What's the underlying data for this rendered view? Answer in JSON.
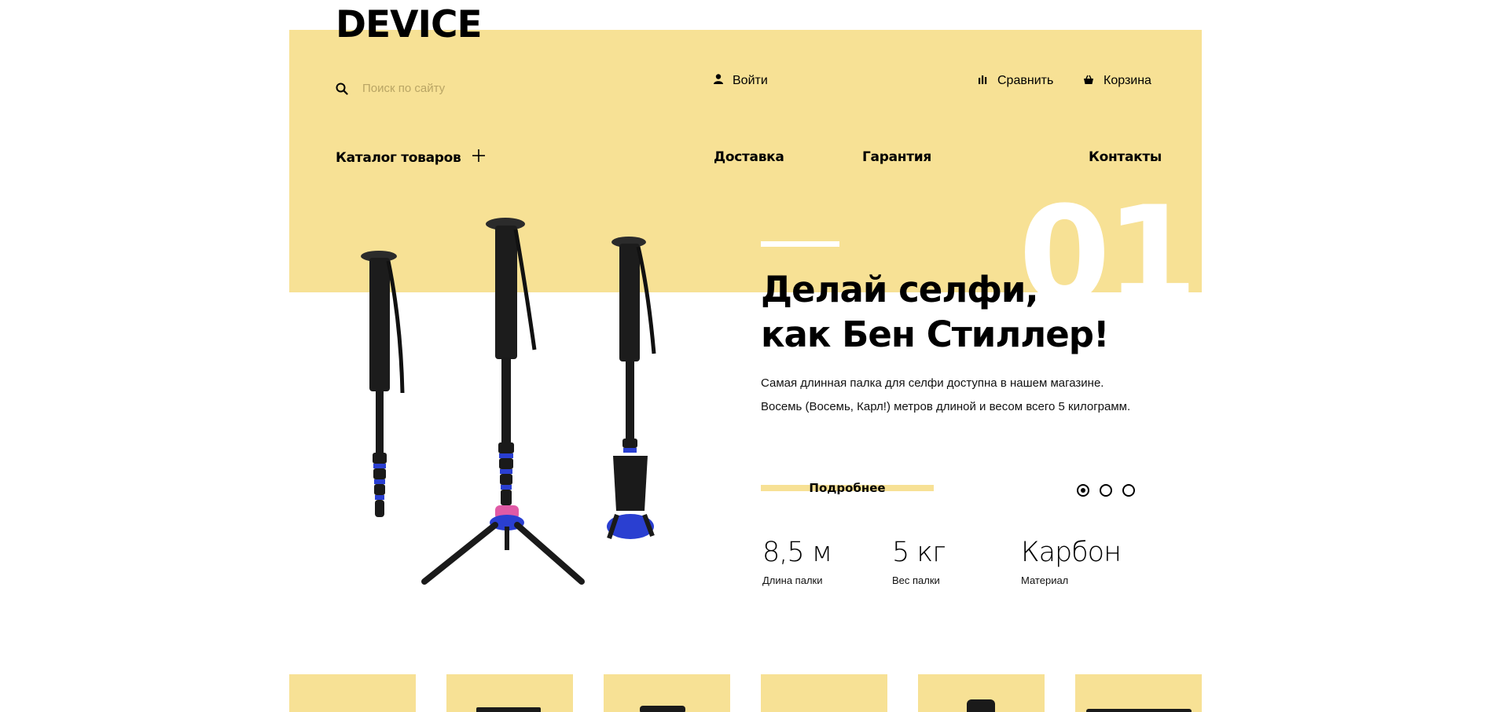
{
  "header": {
    "logo": "DEVICE",
    "search": {
      "placeholder": "Поиск по сайту",
      "icon": "search-icon"
    },
    "login": {
      "label": "Войти",
      "icon": "user-icon"
    },
    "compare": {
      "label": "Сравнить",
      "icon": "bar-chart-icon"
    },
    "cart": {
      "label": "Корзина",
      "icon": "basket-icon"
    }
  },
  "nav": {
    "catalog": "Каталог товаров",
    "delivery": "Доставка",
    "warranty": "Гарантия",
    "contacts": "Контакты"
  },
  "slider": {
    "number": "01",
    "headline_line1": "Делай селфи,",
    "headline_line2": "как Бен Стиллер!",
    "description_line1": "Самая длинная палка для селфи доступна в нашем магазине.",
    "description_line2": "Восемь (Восемь, Карл!) метров длиной и весом всего 5 килограмм.",
    "more_button": "Подробнее",
    "dots_count": 3,
    "active_dot": 1
  },
  "specs": [
    {
      "value": "8,5 м",
      "caption": "Длина палки"
    },
    {
      "value": "5 кг",
      "caption": "Вес палки"
    },
    {
      "value": "Карбон",
      "caption": "Материал"
    }
  ],
  "colors": {
    "accent_yellow": "#f7e195",
    "text": "#000000",
    "background": "#ffffff"
  }
}
